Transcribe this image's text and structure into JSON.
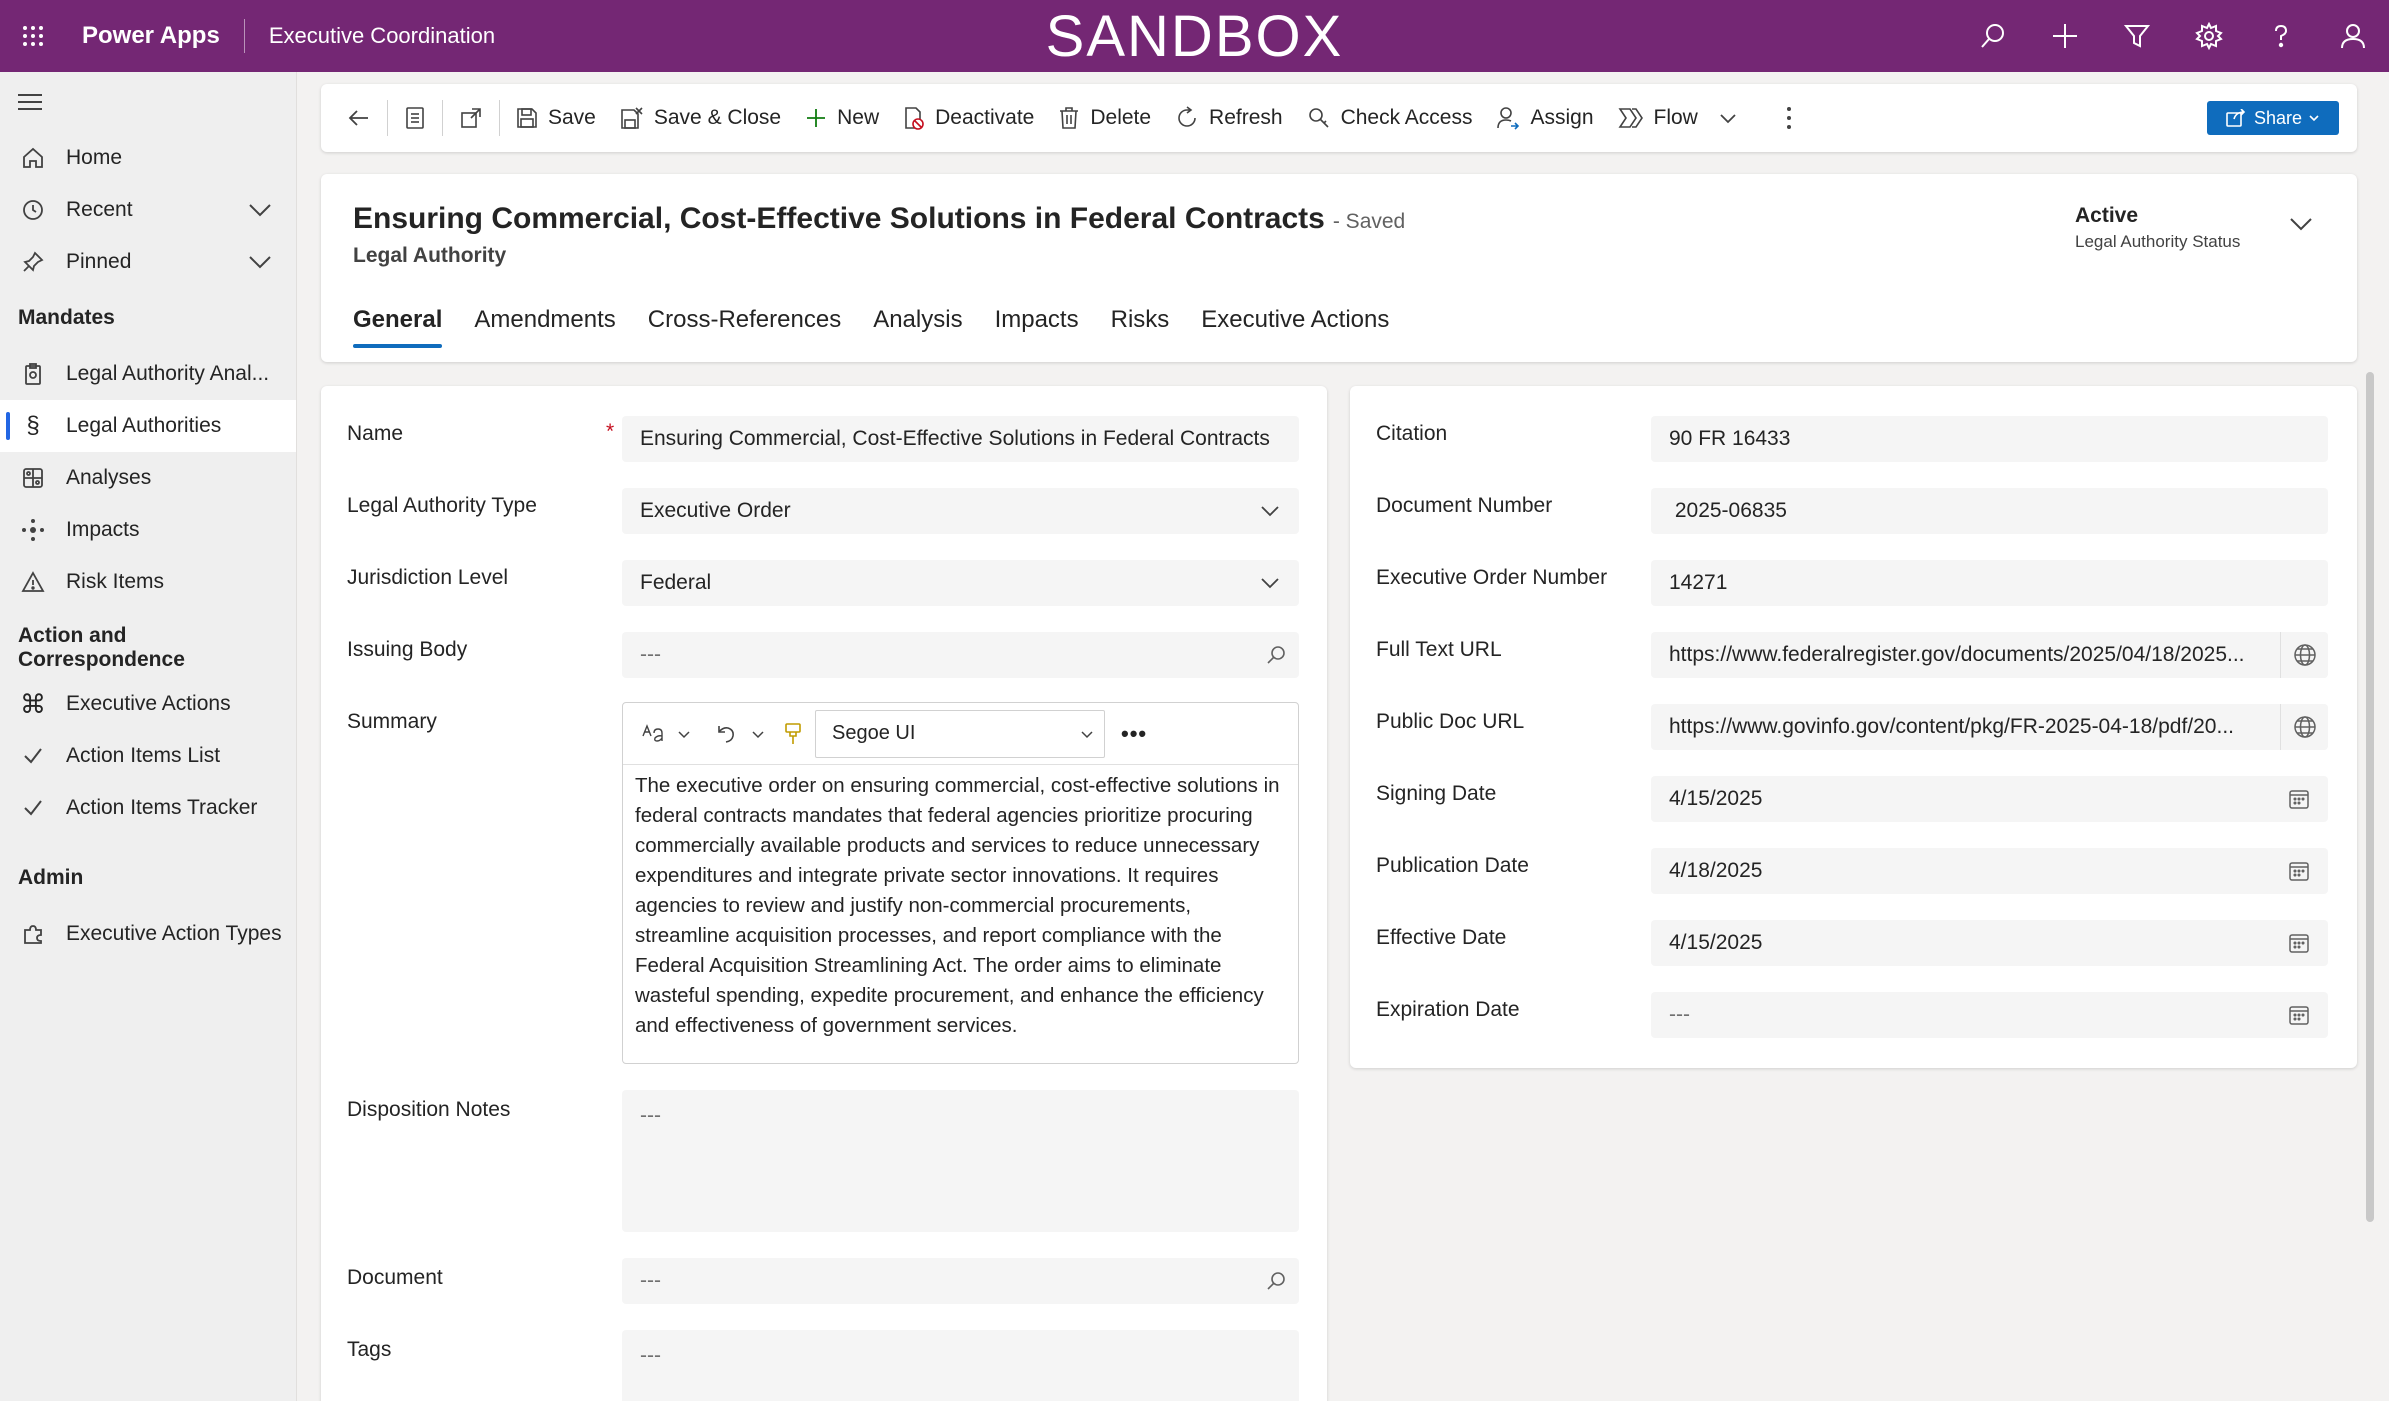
{
  "topbar": {
    "app_name": "Power Apps",
    "environment": "Executive Coordination",
    "banner": "SANDBOX",
    "icons": [
      "search-icon",
      "plus-icon",
      "filter-icon",
      "settings-icon",
      "help-icon",
      "user-icon"
    ],
    "color": "#742774"
  },
  "sidebar": {
    "top_items": [
      {
        "label": "Home",
        "icon": "home-icon"
      },
      {
        "label": "Recent",
        "icon": "clock-icon",
        "expandable": true
      },
      {
        "label": "Pinned",
        "icon": "pin-icon",
        "expandable": true
      }
    ],
    "sections": [
      {
        "title": "Mandates",
        "items": [
          {
            "label": "Legal Authority Anal...",
            "icon": "clipboard-icon"
          },
          {
            "label": "Legal Authorities",
            "icon": "section-icon",
            "active": true
          },
          {
            "label": "Analyses",
            "icon": "analysis-icon"
          },
          {
            "label": "Impacts",
            "icon": "impacts-icon"
          },
          {
            "label": "Risk Items",
            "icon": "warning-icon"
          }
        ]
      },
      {
        "title": "Action and Correspondence",
        "items": [
          {
            "label": "Executive Actions",
            "icon": "command-icon"
          },
          {
            "label": "Action Items List",
            "icon": "check-icon"
          },
          {
            "label": "Action Items Tracker",
            "icon": "check-icon"
          }
        ]
      },
      {
        "title": "Admin",
        "items": [
          {
            "label": "Executive Action Types",
            "icon": "puzzle-icon"
          }
        ]
      }
    ]
  },
  "commandbar": {
    "save": "Save",
    "save_close": "Save & Close",
    "new": "New",
    "deactivate": "Deactivate",
    "delete": "Delete",
    "refresh": "Refresh",
    "check_access": "Check Access",
    "assign": "Assign",
    "flow": "Flow",
    "share": "Share"
  },
  "record": {
    "title": "Ensuring Commercial, Cost-Effective Solutions in Federal Contracts",
    "saved_state": "- Saved",
    "entity": "Legal Authority",
    "status_value": "Active",
    "status_label": "Legal Authority Status"
  },
  "tabs": [
    "General",
    "Amendments",
    "Cross-References",
    "Analysis",
    "Impacts",
    "Risks",
    "Executive Actions"
  ],
  "form_left": {
    "name_label": "Name",
    "name_value": "Ensuring Commercial, Cost-Effective Solutions in Federal Contracts",
    "type_label": "Legal Authority Type",
    "type_value": "Executive Order",
    "jurisdiction_label": "Jurisdiction Level",
    "jurisdiction_value": "Federal",
    "issuing_label": "Issuing Body",
    "issuing_value": "---",
    "summary_label": "Summary",
    "summary_font": "Segoe UI",
    "summary_text": "The executive order on ensuring commercial, cost-effective solutions in federal contracts mandates that federal agencies prioritize procuring commercially available products and services to reduce unnecessary expenditures and integrate private sector innovations. It requires agencies to review and justify non-commercial procurements, streamline acquisition processes, and report compliance with the Federal Acquisition Streamlining Act. The order aims to eliminate wasteful spending, expedite procurement, and enhance the efficiency and effectiveness of government services.",
    "disposition_label": "Disposition Notes",
    "disposition_value": "---",
    "document_label": "Document",
    "document_value": "---",
    "tags_label": "Tags",
    "tags_value": "---"
  },
  "form_right": {
    "citation_label": "Citation",
    "citation_value": "90 FR 16433",
    "docnum_label": "Document Number",
    "docnum_value": " 2025-06835",
    "eonum_label": "Executive Order Number",
    "eonum_value": "14271",
    "fulltext_label": "Full Text URL",
    "fulltext_value": "https://www.federalregister.gov/documents/2025/04/18/2025...",
    "publicdoc_label": "Public Doc URL",
    "publicdoc_value": "https://www.govinfo.gov/content/pkg/FR-2025-04-18/pdf/20...",
    "signing_label": "Signing Date",
    "signing_value": "4/15/2025",
    "publication_label": "Publication Date",
    "publication_value": "4/18/2025",
    "effective_label": "Effective Date",
    "effective_value": "4/15/2025",
    "expiration_label": "Expiration Date",
    "expiration_value": "---"
  }
}
